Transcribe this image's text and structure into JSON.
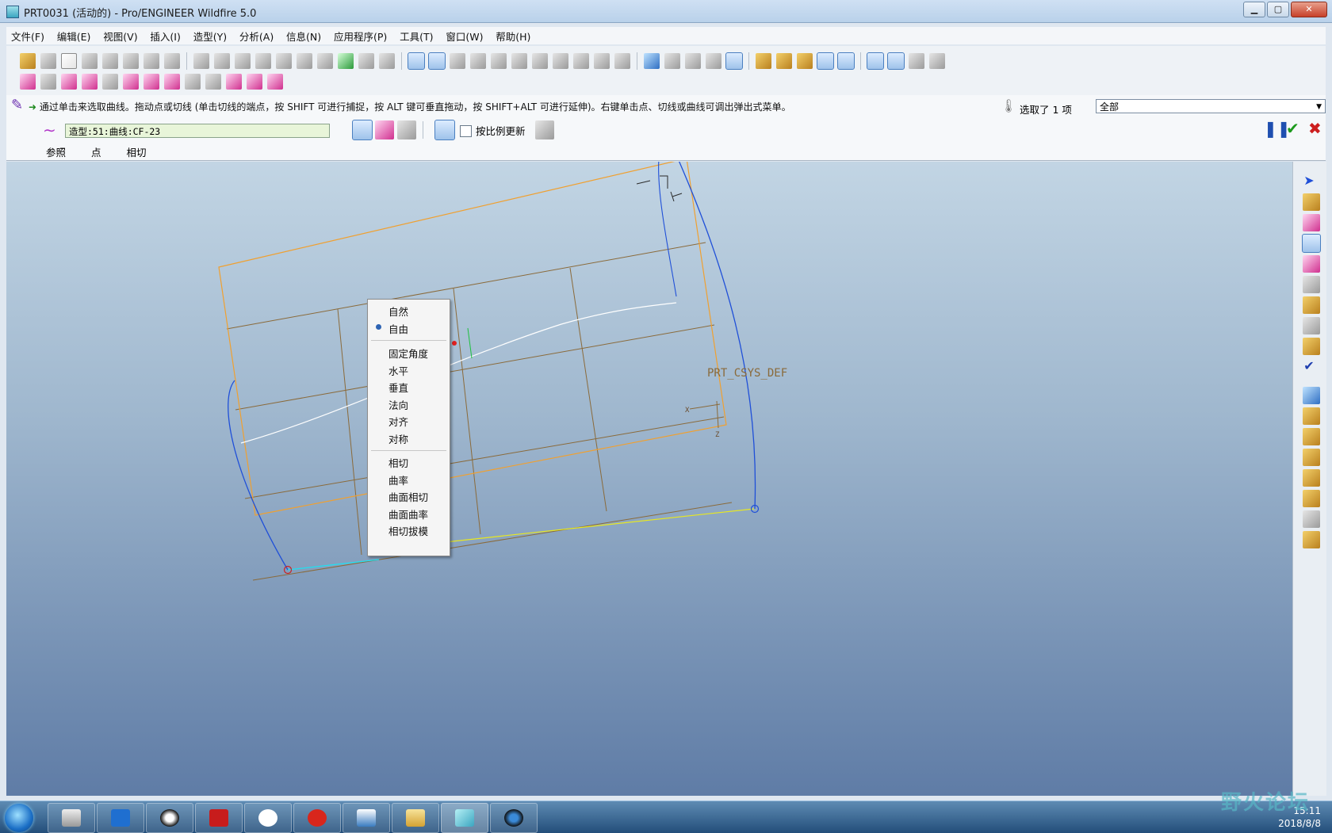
{
  "window": {
    "title": "PRT0031 (活动的) - Pro/ENGINEER Wildfire 5.0",
    "min_label": "▁",
    "max_label": "▢",
    "close_label": "✕"
  },
  "menu": [
    "文件(F)",
    "编辑(E)",
    "视图(V)",
    "插入(I)",
    "造型(Y)",
    "分析(A)",
    "信息(N)",
    "应用程序(P)",
    "工具(T)",
    "窗口(W)",
    "帮助(H)"
  ],
  "dashboard": {
    "message": "通过单击来选取曲线。拖动点或切线 (单击切线的端点，按 SHIFT 可进行捕捉，按 ALT 键可垂直拖动，按 SHIFT+ALT 可进行延伸)。右键单击点、切线或曲线可调出弹出式菜单。",
    "selection_info": "选取了 1 项",
    "filter_value": "全部",
    "curve_field": "造型:51:曲线:CF-23",
    "proportional_update_label": "按比例更新",
    "tabs": [
      "参照",
      "点",
      "相切"
    ]
  },
  "viewport": {
    "csys_label": "PRT_CSYS_DEF",
    "axis_x": "X",
    "axis_z": "Z"
  },
  "context_menu": {
    "items": [
      "自然",
      "自由",
      "固定角度",
      "水平",
      "垂直",
      "法向",
      "对齐",
      "对称",
      "相切",
      "曲率",
      "曲面相切",
      "曲面曲率",
      "相切拔模"
    ],
    "selected": "自由"
  },
  "taskbar": {
    "time": "15:11",
    "date": "2018/8/8"
  },
  "watermark": {
    "text": "野火论坛"
  },
  "colors": {
    "grid": "#8a6a3a",
    "boundary": "#f0a030",
    "curve_blue": "#1f4fd8",
    "curve_white": "#ffffff",
    "yellow_edge": "#e8e820",
    "cyan_edge": "#20e0f0"
  }
}
